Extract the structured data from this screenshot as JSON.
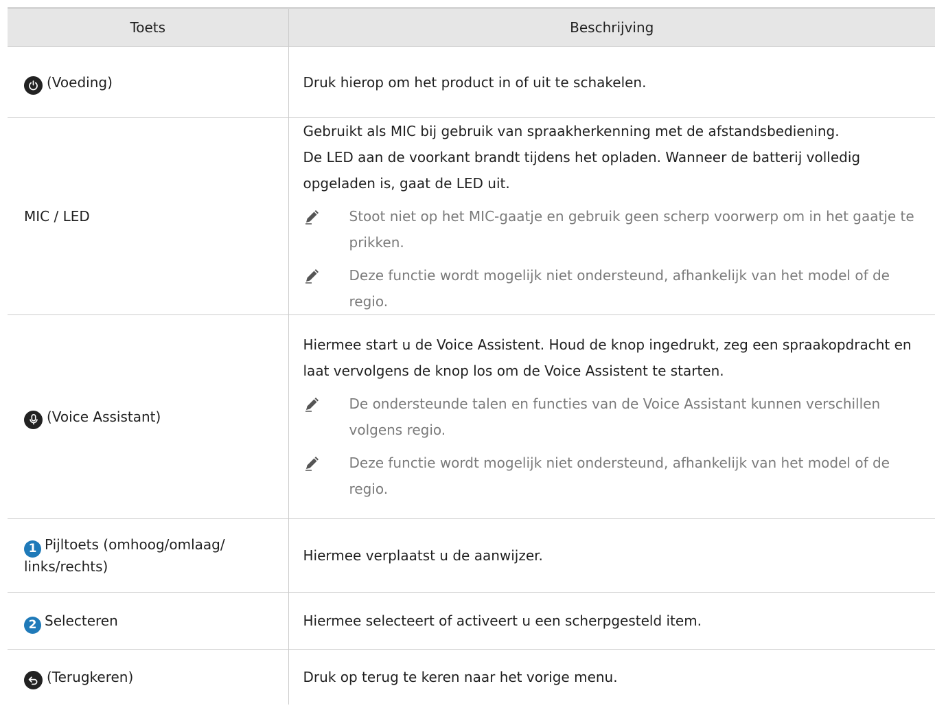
{
  "table": {
    "headers": {
      "key": "Toets",
      "desc": "Beschrijving"
    },
    "rows": {
      "power": {
        "icon": "power-icon",
        "key": "(Voeding)",
        "desc": "Druk hierop om het product in of uit te schakelen."
      },
      "mic": {
        "key": "MIC / LED",
        "desc1": "Gebruikt als MIC bij gebruik van spraakherkenning met de afstandsbediening.",
        "desc2": "De LED aan de voorkant brandt tijdens het opladen. Wanneer de batterij volledig opgeladen is, gaat de LED uit.",
        "note1": "Stoot niet op het MIC-gaatje en gebruik geen scherp voorwerp om in het gaatje te prikken.",
        "note2": "Deze functie wordt mogelijk niet ondersteund, afhankelijk van het model of de regio."
      },
      "voice": {
        "icon": "microphone-icon",
        "key": "(Voice Assistant)",
        "desc": "Hiermee start u de Voice Assistent. Houd de knop ingedrukt, zeg een spraakopdracht en laat vervolgens de knop los om de Voice Assistent te starten.",
        "note1": "De ondersteunde talen en functies van de Voice Assistant kunnen verschillen volgens regio.",
        "note2": "Deze functie wordt mogelijk niet ondersteund, afhankelijk van het model of de regio."
      },
      "arrow": {
        "badge": "1",
        "key": "Pijltoets (omhoog/omlaag/ links/rechts)",
        "desc": "Hiermee verplaatst u de aanwijzer."
      },
      "select": {
        "badge": "2",
        "key": "Selecteren",
        "desc": "Hiermee selecteert of activeert u een scherpgesteld item."
      },
      "return": {
        "icon": "return-icon",
        "key": "(Terugkeren)",
        "desc": "Druk op terug te keren naar het vorige menu."
      }
    }
  },
  "colors": {
    "header_bg": "#e6e6e6",
    "badge": "#1f7ab9",
    "note_text": "#7a7a7a"
  }
}
